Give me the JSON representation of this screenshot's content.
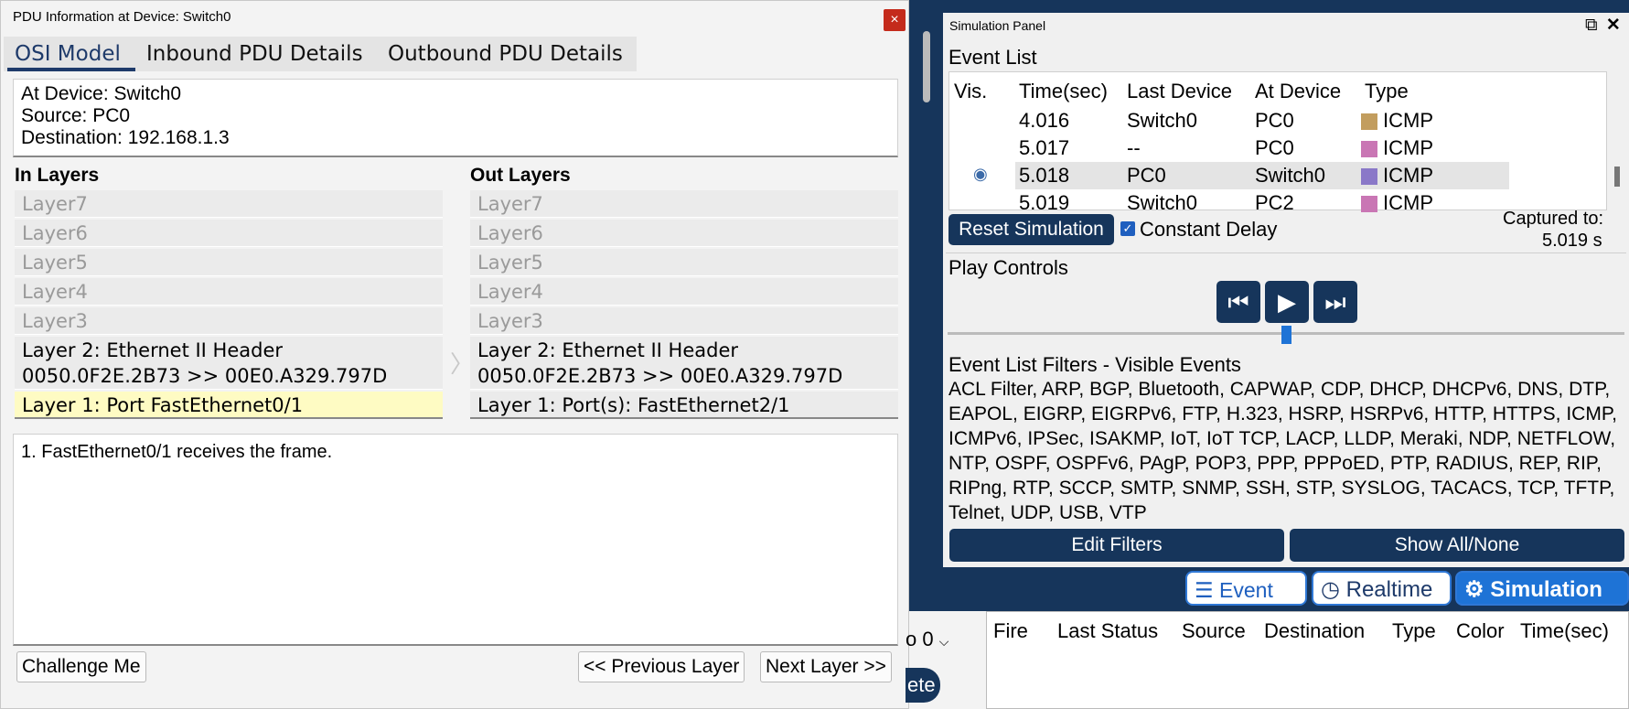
{
  "pdu": {
    "title": "PDU Information at Device: Switch0",
    "close": "×",
    "tabs": [
      "OSI Model",
      "Inbound PDU Details",
      "Outbound PDU Details"
    ],
    "info": [
      "At Device: Switch0",
      "Source: PC0",
      "Destination: 192.168.1.3"
    ],
    "in_title": "In Layers",
    "out_title": "Out Layers",
    "in_layers": [
      "Layer7",
      "Layer6",
      "Layer5",
      "Layer4",
      "Layer3",
      "Layer 2: Ethernet II Header",
      "0050.0F2E.2B73 >> 00E0.A329.797D",
      "Layer 1: Port FastEthernet0/1"
    ],
    "out_layers": [
      "Layer7",
      "Layer6",
      "Layer5",
      "Layer4",
      "Layer3",
      "Layer 2: Ethernet II Header",
      "0050.0F2E.2B73 >> 00E0.A329.797D",
      "Layer 1: Port(s): FastEthernet2/1"
    ],
    "description": "1. FastEthernet0/1 receives the frame.",
    "buttons": {
      "challenge": "Challenge Me",
      "prev": "<< Previous Layer",
      "next": "Next Layer >>"
    }
  },
  "sim": {
    "title": "Simulation Panel",
    "event_list_title": "Event List",
    "columns": [
      "Vis.",
      "Time(sec)",
      "Last Device",
      "At Device",
      "Type"
    ],
    "events": [
      {
        "time": "4.016",
        "last": "Switch0",
        "at": "PC0",
        "type": "ICMP",
        "color": "#c29d5e"
      },
      {
        "time": "5.017",
        "last": "--",
        "at": "PC0",
        "type": "ICMP",
        "color": "#c976b4"
      },
      {
        "time": "5.018",
        "last": "PC0",
        "at": "Switch0",
        "type": "ICMP",
        "color": "#8a78c8"
      },
      {
        "time": "5.019",
        "last": "Switch0",
        "at": "PC2",
        "type": "ICMP",
        "color": "#c976b4"
      }
    ],
    "reset_label": "Reset Simulation",
    "constant_delay": "Constant Delay",
    "captured_label": "Captured to:",
    "captured_value": "5.019 s",
    "play_title": "Play Controls",
    "play_progress": 0.44,
    "filters_title": "Event List Filters - Visible Events",
    "filters": "ACL Filter, ARP, BGP, Bluetooth, CAPWAP, CDP, DHCP, DHCPv6, DNS, DTP, EAPOL, EIGRP, EIGRPv6, FTP, H.323, HSRP, HSRPv6, HTTP, HTTPS, ICMP, ICMPv6, IPSec, ISAKMP, IoT, IoT TCP, LACP, LLDP, Meraki, NDP, NETFLOW, NTP, OSPF, OSPFv6, PAgP, POP3, PPP, PPPoED, PTP, RADIUS, REP, RIP, RIPng, RTP, SCCP, SMTP, SNMP, SSH, STP, SYSLOG, TACACS, TCP, TFTP, Telnet, UDP, USB, VTP",
    "edit_filters": "Edit Filters",
    "show_all": "Show All/None"
  },
  "modes": {
    "event_list": "Event List",
    "realtime": "Realtime",
    "simulation": "Simulation"
  },
  "pdu_list": {
    "columns": [
      "Fire",
      "Last Status",
      "Source",
      "Destination",
      "Type",
      "Color",
      "Time(sec)"
    ],
    "scenario_value": "o 0",
    "delete_label": "ete"
  }
}
